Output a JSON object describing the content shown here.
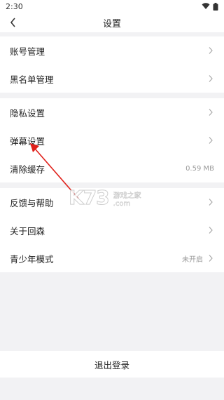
{
  "status_bar": {
    "time": "2:30"
  },
  "header": {
    "title": "设置"
  },
  "groups": [
    {
      "items": [
        {
          "label": "账号管理"
        },
        {
          "label": "黑名单管理"
        }
      ]
    },
    {
      "items": [
        {
          "label": "隐私设置"
        },
        {
          "label": "弹幕设置"
        },
        {
          "label": "清除缓存",
          "value": "0.59 MB"
        }
      ]
    },
    {
      "items": [
        {
          "label": "反馈与帮助"
        },
        {
          "label": "关于回森"
        },
        {
          "label": "青少年模式",
          "value": "未开启"
        }
      ]
    }
  ],
  "logout_label": "退出登录",
  "watermark": {
    "logo": "K73",
    "line1": "游戏之家",
    "line2": ".com"
  },
  "annotation": {
    "arrow_color": "#e0201a"
  }
}
